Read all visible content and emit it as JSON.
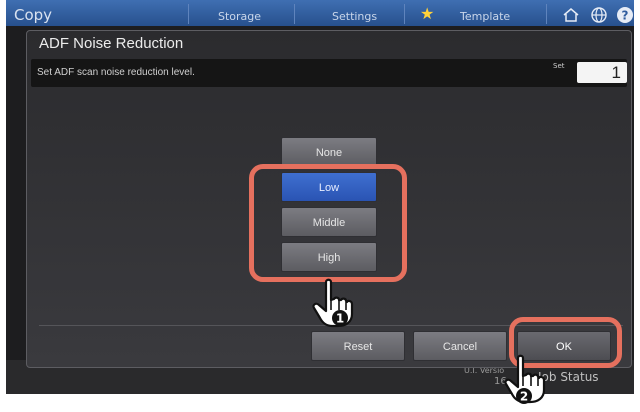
{
  "background": {
    "app_title": "Copy",
    "top_items": [
      "Storage",
      "Settings",
      "Template"
    ],
    "version_line1": "U.I. Versio",
    "version_line2": "16",
    "job_status": "Job Status"
  },
  "dialog": {
    "title": "ADF Noise Reduction",
    "instruction": "Set ADF scan noise reduction level.",
    "set_label": "Set",
    "set_value": "1",
    "options": [
      {
        "label": "None",
        "selected": false
      },
      {
        "label": "Low",
        "selected": true
      },
      {
        "label": "Middle",
        "selected": false
      },
      {
        "label": "High",
        "selected": false
      }
    ],
    "buttons": {
      "reset": "Reset",
      "cancel": "Cancel",
      "ok": "OK"
    }
  },
  "callouts": {
    "step1": "1",
    "step2": "2"
  },
  "colors": {
    "highlight": "#e5705e",
    "selected_option": "#3560c2",
    "topbar": "#2f5c9e"
  },
  "icons": [
    "star-icon",
    "home-icon",
    "globe-icon",
    "help-icon",
    "pointing-hand-icon"
  ]
}
